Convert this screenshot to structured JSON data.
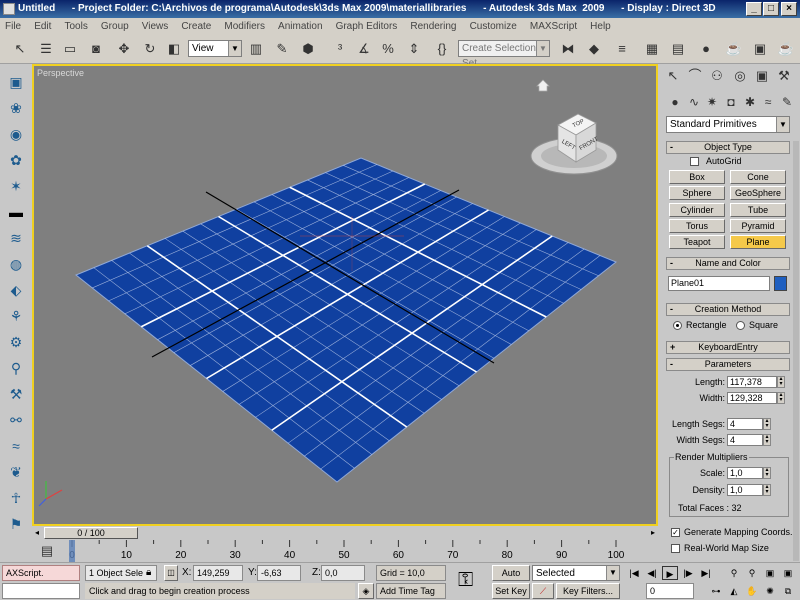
{
  "window": {
    "title": "Untitled      - Project Folder: C:\\Archivos de programa\\Autodesk\\3ds Max 2009\\materiallibraries      - Autodesk 3ds Max  2009      - Display : Direct 3D"
  },
  "menu": [
    "File",
    "Edit",
    "Tools",
    "Group",
    "Views",
    "Create",
    "Modifiers",
    "Animation",
    "Graph Editors",
    "Rendering",
    "Customize",
    "MAXScript",
    "Help"
  ],
  "toolbar": {
    "reference_coord": "View",
    "selection_set_placeholder": "Create Selection Set"
  },
  "viewport": {
    "label": "Perspective",
    "viewcube": {
      "top": "TOP",
      "left": "LEFT",
      "front": "FRONT"
    },
    "background": "#7f7f7f",
    "plane_color": "#1040a0",
    "border_color": "#f0d020"
  },
  "time_slider": {
    "value": "0 / 100",
    "ticks": [
      "0",
      "10",
      "20",
      "30",
      "40",
      "50",
      "60",
      "70",
      "80",
      "90",
      "100"
    ]
  },
  "command_panel": {
    "category_dropdown": "Standard Primitives",
    "object_type": {
      "header": "Object Type",
      "autogrid_label": "AutoGrid",
      "buttons": [
        "Box",
        "Cone",
        "Sphere",
        "GeoSphere",
        "Cylinder",
        "Tube",
        "Torus",
        "Pyramid",
        "Teapot",
        "Plane"
      ],
      "active": "Plane"
    },
    "name_and_color": {
      "header": "Name and Color",
      "name_value": "Plane01",
      "color": "#1f5fc0"
    },
    "creation_method": {
      "header": "Creation Method",
      "options": [
        "Rectangle",
        "Square"
      ],
      "selected": "Rectangle"
    },
    "keyboard_entry": {
      "header": "KeyboardEntry"
    },
    "parameters": {
      "header": "Parameters",
      "length_label": "Length:",
      "length": "117,378",
      "width_label": "Width:",
      "width": "129,328",
      "length_segs_label": "Length Segs:",
      "length_segs": "4",
      "width_segs_label": "Width Segs:",
      "width_segs": "4",
      "render_multipliers_label": "Render Multipliers",
      "scale_label": "Scale:",
      "scale": "1,0",
      "density_label": "Density:",
      "density": "1,0",
      "total_faces": "Total Faces : 32",
      "gen_mapping_label": "Generate Mapping Coords.",
      "realworld_label": "Real-World Map Size"
    }
  },
  "status": {
    "maxscript_label": "AXScript.",
    "selection": "1 Object Sele",
    "x_label": "X:",
    "x_value": "149,259",
    "y_label": "Y:",
    "y_value": "-6,63",
    "z_label": "Z:",
    "z_value": "0,0",
    "grid": "Grid = 10,0",
    "prompt": "Click and drag to begin creation process",
    "add_time_tag": "Add Time Tag",
    "auto_key": "Auto Key",
    "set_key": "Set Key",
    "key_mode": "Selected",
    "key_filters": "Key Filters...",
    "frame": "0"
  }
}
